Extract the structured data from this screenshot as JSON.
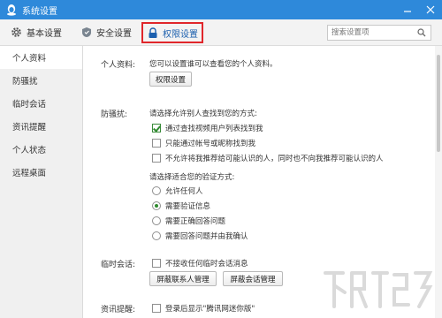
{
  "window": {
    "title": "系统设置",
    "controls": [
      "minimize",
      "close"
    ]
  },
  "toolbar": {
    "tabs": [
      {
        "label": "基本设置",
        "icon": "gear-icon"
      },
      {
        "label": "安全设置",
        "icon": "shield-icon"
      },
      {
        "label": "权限设置",
        "icon": "lock-icon",
        "active": true
      }
    ],
    "search_placeholder": "搜索设置项"
  },
  "sidebar": {
    "items": [
      {
        "label": "个人资料",
        "active": true
      },
      {
        "label": "防骚扰"
      },
      {
        "label": "临时会话"
      },
      {
        "label": "资讯提醒"
      },
      {
        "label": "个人状态"
      },
      {
        "label": "远程桌面"
      }
    ]
  },
  "profile": {
    "label": "个人资料:",
    "desc": "您可以设置谁可以查看您的个人资料。",
    "button": "权限设置"
  },
  "anti_harass": {
    "label": "防骚扰:",
    "prompt_find": "请选择允许别人查找到您的方式:",
    "find_options": [
      {
        "label": "通过查找视频用户列表找到我",
        "checked": true
      },
      {
        "label": "只能通过帐号或昵称找到我",
        "checked": false
      },
      {
        "label": "不允许将我推荐给可能认识的人，同时也不向我推荐可能认识的人",
        "checked": false
      }
    ],
    "prompt_verify": "请选择适合您的验证方式:",
    "verify_options": [
      {
        "label": "允许任何人",
        "checked": false
      },
      {
        "label": "需要验证信息",
        "checked": true
      },
      {
        "label": "需要正确回答问题",
        "checked": false
      },
      {
        "label": "需要回答问题并由我确认",
        "checked": false
      }
    ]
  },
  "temp_session": {
    "label": "临时会话:",
    "option": "不接收任何临时会话消息",
    "btn_block_contacts": "屏蔽联系人管理",
    "btn_block_sessions": "屏蔽会话管理"
  },
  "news": {
    "label": "资讯提醒:",
    "option": "登录后显示\"腾讯网迷你版\""
  },
  "colors": {
    "titlebar": "#2e89da",
    "highlight_border": "#e0262b",
    "check": "#2f8a2f"
  }
}
